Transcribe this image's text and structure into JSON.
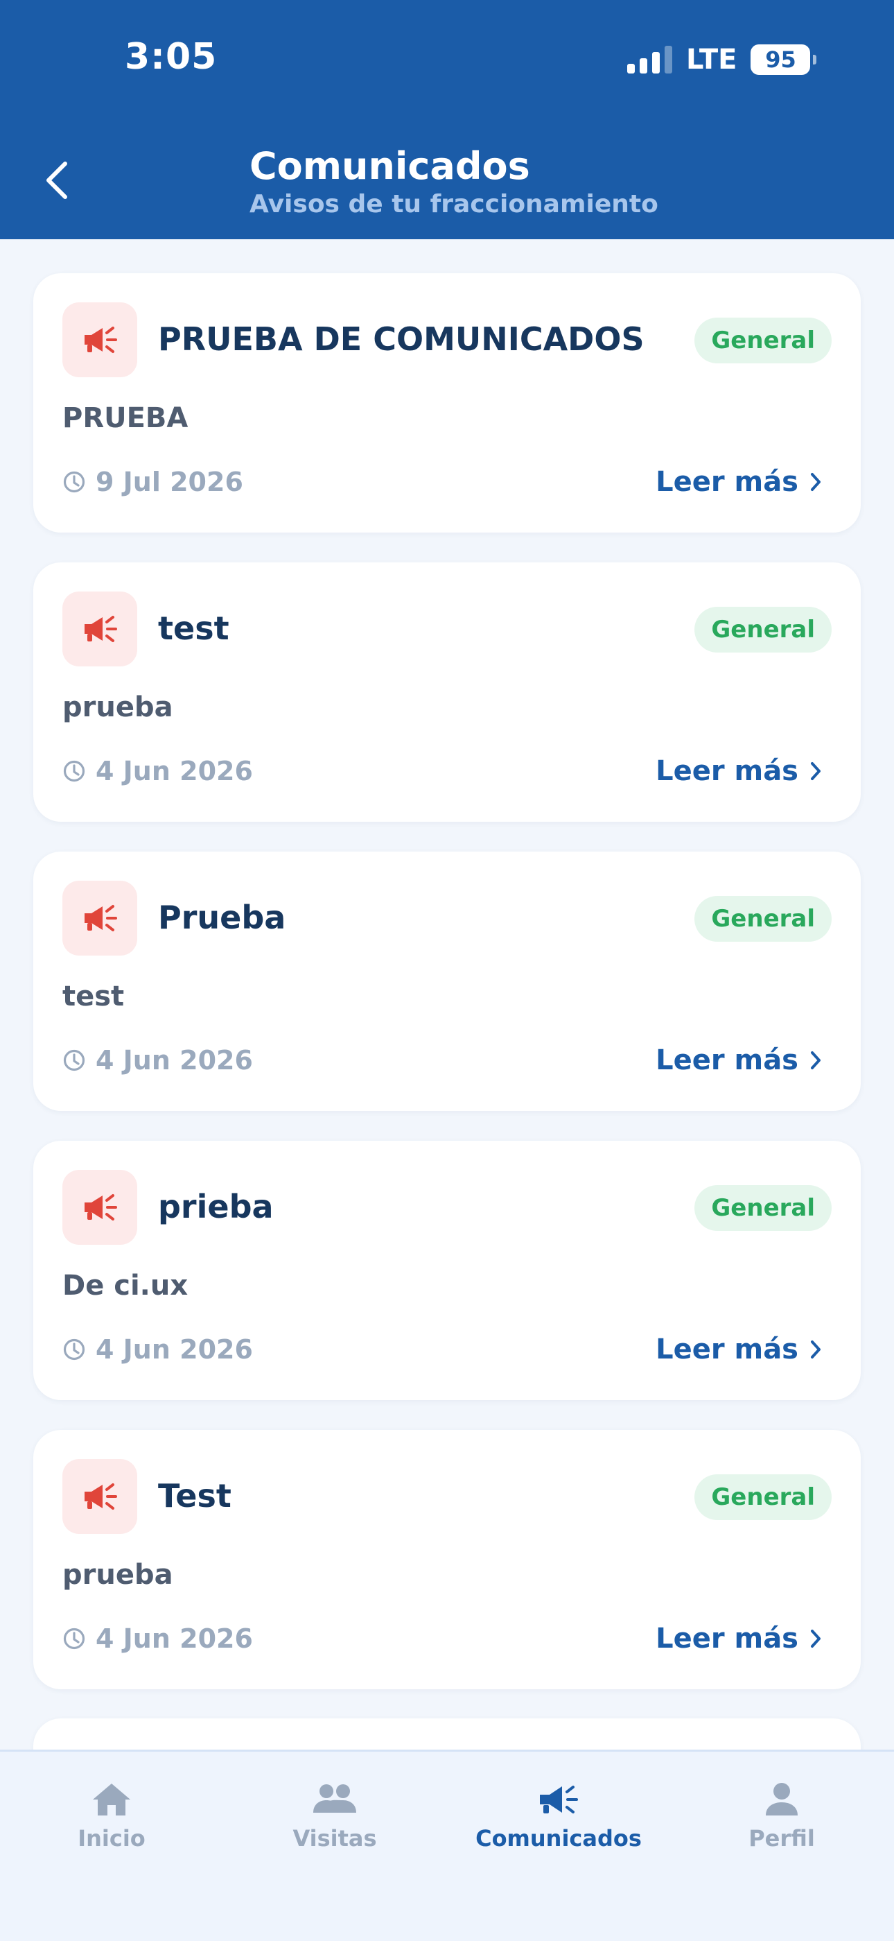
{
  "status_bar": {
    "time": "3:05",
    "network": "LTE",
    "battery": "95"
  },
  "header": {
    "title": "Comunicados",
    "subtitle": "Avisos de tu fraccionamiento"
  },
  "announcements": [
    {
      "title": "PRUEBA DE COMUNICADOS",
      "badge": "General",
      "body": "PRUEBA",
      "date": "9 Jul 2026",
      "action": "Leer más"
    },
    {
      "title": "test",
      "badge": "General",
      "body": "prueba",
      "date": "4 Jun 2026",
      "action": "Leer más"
    },
    {
      "title": "Prueba",
      "badge": "General",
      "body": "test",
      "date": "4 Jun 2026",
      "action": "Leer más"
    },
    {
      "title": "prieba",
      "badge": "General",
      "body": "De ci.ux",
      "date": "4 Jun 2026",
      "action": "Leer más"
    },
    {
      "title": "Test",
      "badge": "General",
      "body": "prueba",
      "date": "4 Jun 2026",
      "action": "Leer más"
    }
  ],
  "tab_bar": [
    {
      "label": "Inicio",
      "icon": "home-icon",
      "active": false
    },
    {
      "label": "Visitas",
      "icon": "people-icon",
      "active": false
    },
    {
      "label": "Comunicados",
      "icon": "megaphone-icon",
      "active": true
    },
    {
      "label": "Perfil",
      "icon": "person-icon",
      "active": false
    }
  ],
  "colors": {
    "header": "#1b5ca8",
    "title_text": "#17375e",
    "badge_bg": "#e5f6ec",
    "badge_text": "#29a85c",
    "icon_red": "#e0453a",
    "muted": "#9aa9bd"
  }
}
